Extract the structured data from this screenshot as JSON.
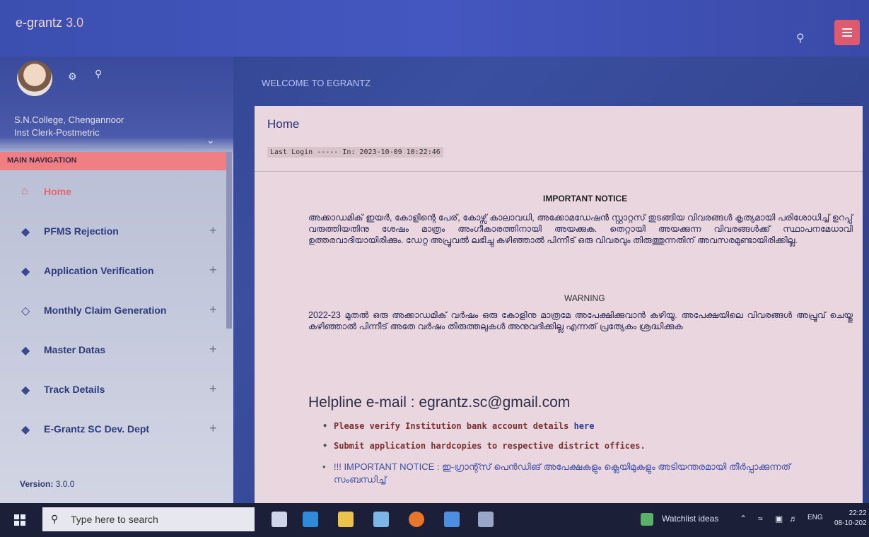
{
  "topbar": {
    "brand": "e-grantz",
    "version": "3.0"
  },
  "sidebar": {
    "college": "S.N.College, Chengannoor",
    "role": "Inst Clerk-Postmetric",
    "section_label": "MAIN NAVIGATION",
    "items": [
      {
        "label": "Home",
        "icon": "home-icon"
      },
      {
        "label": "PFMS Rejection",
        "icon": "layers-icon"
      },
      {
        "label": "Application Verification",
        "icon": "layers-icon"
      },
      {
        "label": "Monthly Claim Generation",
        "icon": "layers-icon"
      },
      {
        "label": "Master Datas",
        "icon": "layers-icon"
      },
      {
        "label": "Track Details",
        "icon": "layers-icon"
      },
      {
        "label": "E-Grantz SC Dev. Dept",
        "icon": "layers-icon"
      }
    ],
    "version_label": "Version:",
    "version_value": "3.0.0"
  },
  "main": {
    "welcome": "WELCOME TO EGRANTZ",
    "card_title": "Home",
    "last_login": "Last Login ----- In: 2023-10-09 10:22:46",
    "important_heading": "IMPORTANT NOTICE",
    "important_text": "അക്കാഡമിക് ഇയർ, കോളിന്റെ പേര്, കോഴ്സ് കാലാവധി, അക്കോമഡേഷൻ സ്റ്റാറ്റസ് തുടങ്ങിയ വിവരങ്ങൾ കൃത്യമായി പരിശോധിച്ച് ഉറപ്പ് വരുത്തിയതിനു ശേഷം മാത്രം അംഗീകാരത്തിനായി അയക്കുക. തെറ്റായി അയക്കുന്ന വിവരങ്ങൾക്ക് സ്ഥാപനമേധാവി ഉത്തരവാദിയായിരിക്കും. ഡേറ്റ അപ്രൂവൽ ലഭിച്ചു കഴിഞ്ഞാൽ പിന്നീട് ഒരു വിവരവും തിരുത്തുന്നതിന് അവസരമുണ്ടായിരിക്കില്ല.",
    "warning_heading": "WARNING",
    "warning_text": "2022-23 മുതൽ ഒരു അക്കാഡമിക് വർഷം ഒരു കോളിനു മാത്രമേ അപേക്ഷിക്കുവാൻ കഴിയൂ. അപേക്ഷയിലെ വിവരങ്ങൾ അപ്രൂവ് ചെയ്തു കഴിഞ്ഞാൽ പിന്നീട് അതേ വർഷം തിരുത്തലുകൾ അനുവദിക്കില്ല എന്നത് പ്രത്യേകം ശ്രദ്ധിക്കുക",
    "helpline": "Helpline e-mail : egrantz.sc@gmail.com",
    "bullet1": "Please verify Institution bank account details",
    "bullet1_link": "here",
    "bullet2": "Submit application hardcopies to respective district offices.",
    "bullet3": "!!! IMPORTANT NOTICE : ഇ-ഗ്രാന്റ്സ് പെൻഡിങ് അപേക്ഷകളും ക്ലെയിമുകളും അടിയന്തരമായി തീർപ്പാക്കുന്നത് സംബന്ധിച്ച്"
  },
  "taskbar": {
    "search_placeholder": "Type here to search",
    "watchlist": "Watchlist ideas",
    "lang": "ENG",
    "time": "22:22",
    "date": "08-10-202"
  }
}
